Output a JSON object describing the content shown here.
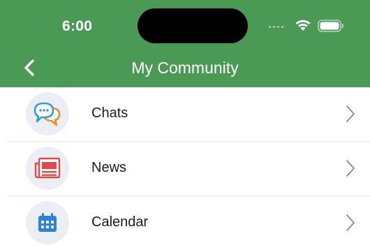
{
  "status_bar": {
    "time": "6:00",
    "icons": [
      "cellular-signal-icon",
      "wifi-icon",
      "battery-icon"
    ]
  },
  "nav": {
    "title": "My Community",
    "back_icon": "chevron-left-icon"
  },
  "colors": {
    "header_bg": "#4a9a56",
    "icon_bg": "#ebeef5",
    "chats_blue": "#2a9fd6",
    "chats_orange": "#f28c28",
    "news_red": "#e04a4a",
    "calendar_blue": "#2b82d9"
  },
  "menu": {
    "items": [
      {
        "label": "Chats",
        "icon": "chat-bubbles-icon"
      },
      {
        "label": "News",
        "icon": "newspaper-icon"
      },
      {
        "label": "Calendar",
        "icon": "calendar-icon"
      }
    ]
  }
}
